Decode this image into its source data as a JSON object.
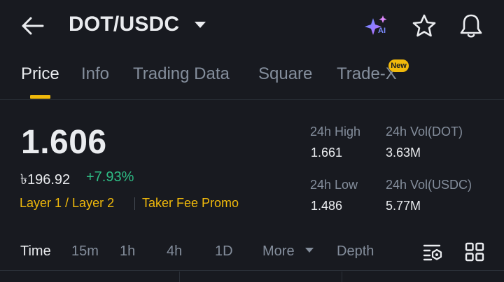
{
  "header": {
    "pair": "DOT/USDC",
    "icons": [
      "back-arrow-icon",
      "caret-down-icon",
      "ai-sparkle-icon",
      "star-icon",
      "bell-icon"
    ],
    "ai_label": "AI"
  },
  "tabs": [
    {
      "label": "Price",
      "active": true
    },
    {
      "label": "Info",
      "active": false
    },
    {
      "label": "Trading Data",
      "active": false
    },
    {
      "label": "Square",
      "active": false
    },
    {
      "label": "Trade-X",
      "active": false,
      "badge": "New"
    }
  ],
  "summary": {
    "price": "1.606",
    "fiat_price": "৳196.92",
    "change": "+7.93%",
    "tags": [
      "Layer 1 / Layer 2",
      "Taker Fee Promo"
    ]
  },
  "stats": {
    "high_label": "24h High",
    "high_value": "1.661",
    "low_label": "24h Low",
    "low_value": "1.486",
    "vol_base_label": "24h Vol(DOT)",
    "vol_base_value": "3.63M",
    "vol_quote_label": "24h Vol(USDC)",
    "vol_quote_value": "5.77M"
  },
  "chart_tabs": [
    {
      "label": "Time",
      "active": true
    },
    {
      "label": "15m",
      "active": false
    },
    {
      "label": "1h",
      "active": false
    },
    {
      "label": "4h",
      "active": false
    },
    {
      "label": "1D",
      "active": false
    },
    {
      "label": "More",
      "active": false
    },
    {
      "label": "Depth",
      "active": false
    }
  ],
  "colors": {
    "background": "#181a20",
    "accent": "#f0b90b",
    "positive": "#2ebd85",
    "muted": "#848e9c",
    "text": "#eaecef"
  }
}
